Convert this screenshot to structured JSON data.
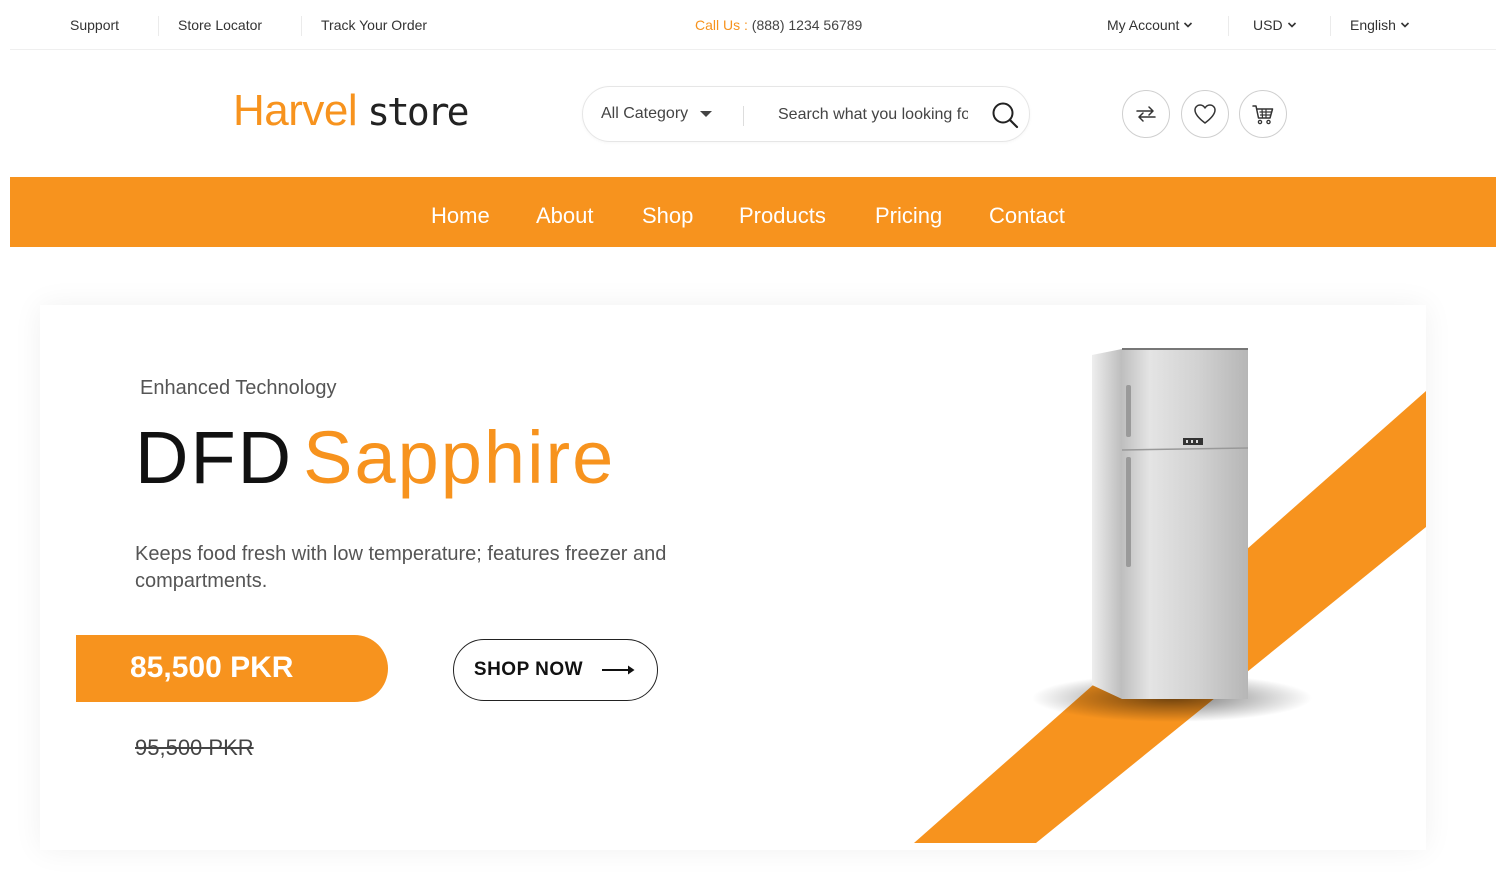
{
  "topbar": {
    "links": [
      "Support",
      "Store Locator",
      "Track Your Order"
    ],
    "call_label": "Call Us :",
    "call_number": " (888) 1234 56789",
    "account": "My Account",
    "currency": "USD",
    "language": "English"
  },
  "header": {
    "logo_main": "Harvel",
    "logo_sub": "store",
    "category": "All Category",
    "search_placeholder": "Search what you looking for",
    "icons": [
      "compare-icon",
      "wishlist-heart-icon",
      "cart-icon"
    ]
  },
  "nav": {
    "items": [
      "Home",
      "About",
      "Shop",
      "Products",
      "Pricing",
      "Contact"
    ]
  },
  "hero": {
    "kicker": "Enhanced Technology",
    "title_dark": "DFD",
    "title_accent": "Sapphire",
    "description": "Keeps food fresh with low temperature; features freezer and compartments.",
    "price": "85,500 PKR",
    "cta": "SHOP NOW",
    "old_price": "95,500 PKR",
    "product_image": "refrigerator"
  },
  "colors": {
    "accent": "#f7931e",
    "text_dark": "#111111",
    "background": "#ffffff"
  }
}
